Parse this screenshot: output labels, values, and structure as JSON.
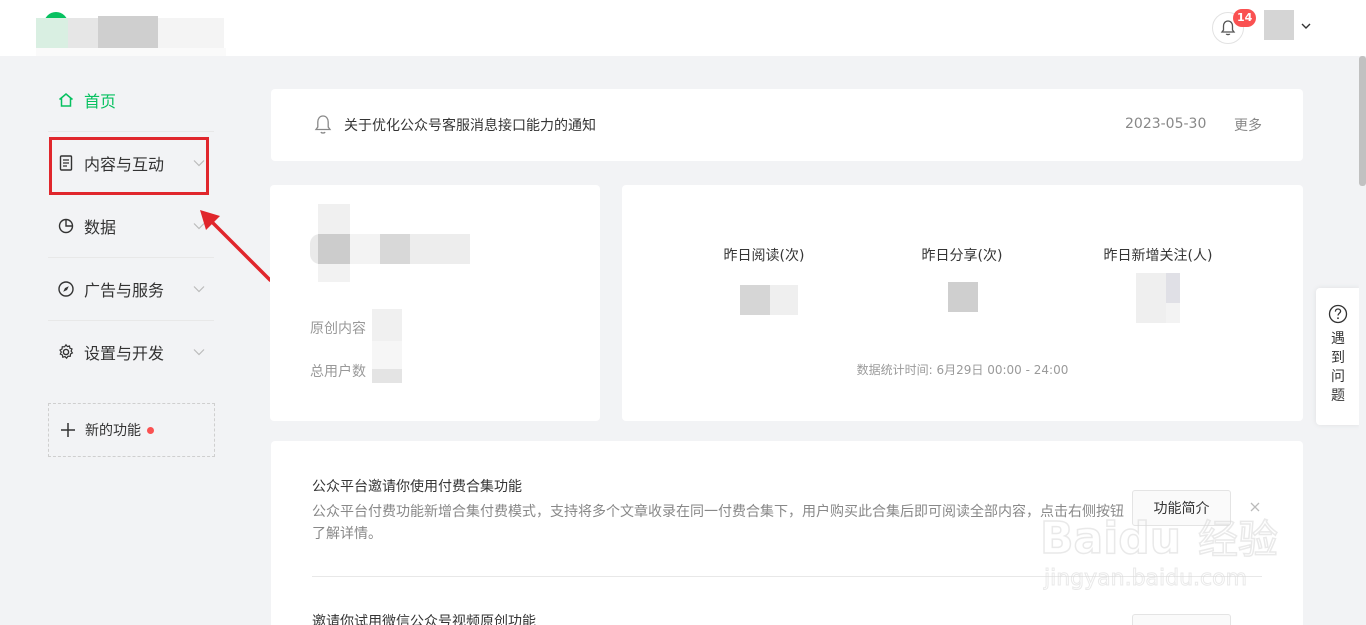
{
  "header": {
    "notification_count": "14"
  },
  "sidebar": {
    "items": [
      {
        "label": "首页",
        "icon": "home-icon"
      },
      {
        "label": "内容与互动",
        "icon": "document-icon"
      },
      {
        "label": "数据",
        "icon": "pie-chart-icon"
      },
      {
        "label": "广告与服务",
        "icon": "compass-icon"
      },
      {
        "label": "设置与开发",
        "icon": "gear-icon"
      }
    ],
    "new_feature_label": "新的功能"
  },
  "notice": {
    "title": "关于优化公众号客服消息接口能力的通知",
    "date": "2023-05-30",
    "more_label": "更多"
  },
  "account": {
    "original_content_label": "原创内容",
    "total_users_label": "总用户数"
  },
  "stats": {
    "reads_label": "昨日阅读(次)",
    "shares_label": "昨日分享(次)",
    "new_follows_label": "昨日新增关注(人)",
    "time_range": "数据统计时间: 6月29日 00:00 - 24:00"
  },
  "promo": {
    "heading": "公众平台邀请你使用付费合集功能",
    "description": "公众平台付费功能新增合集付费模式，支持将多个文章收录在同一付费合集下，用户购买此合集后即可阅读全部内容，点击右侧按钮了解详情。",
    "button_label": "功能简介",
    "heading2": "邀请你试用微信公众号视频原创功能"
  },
  "help": {
    "chars": [
      "遇",
      "到",
      "问",
      "题"
    ]
  },
  "colors": {
    "accent": "#07c160",
    "highlight": "#e0262c",
    "badge": "#fa5151"
  }
}
